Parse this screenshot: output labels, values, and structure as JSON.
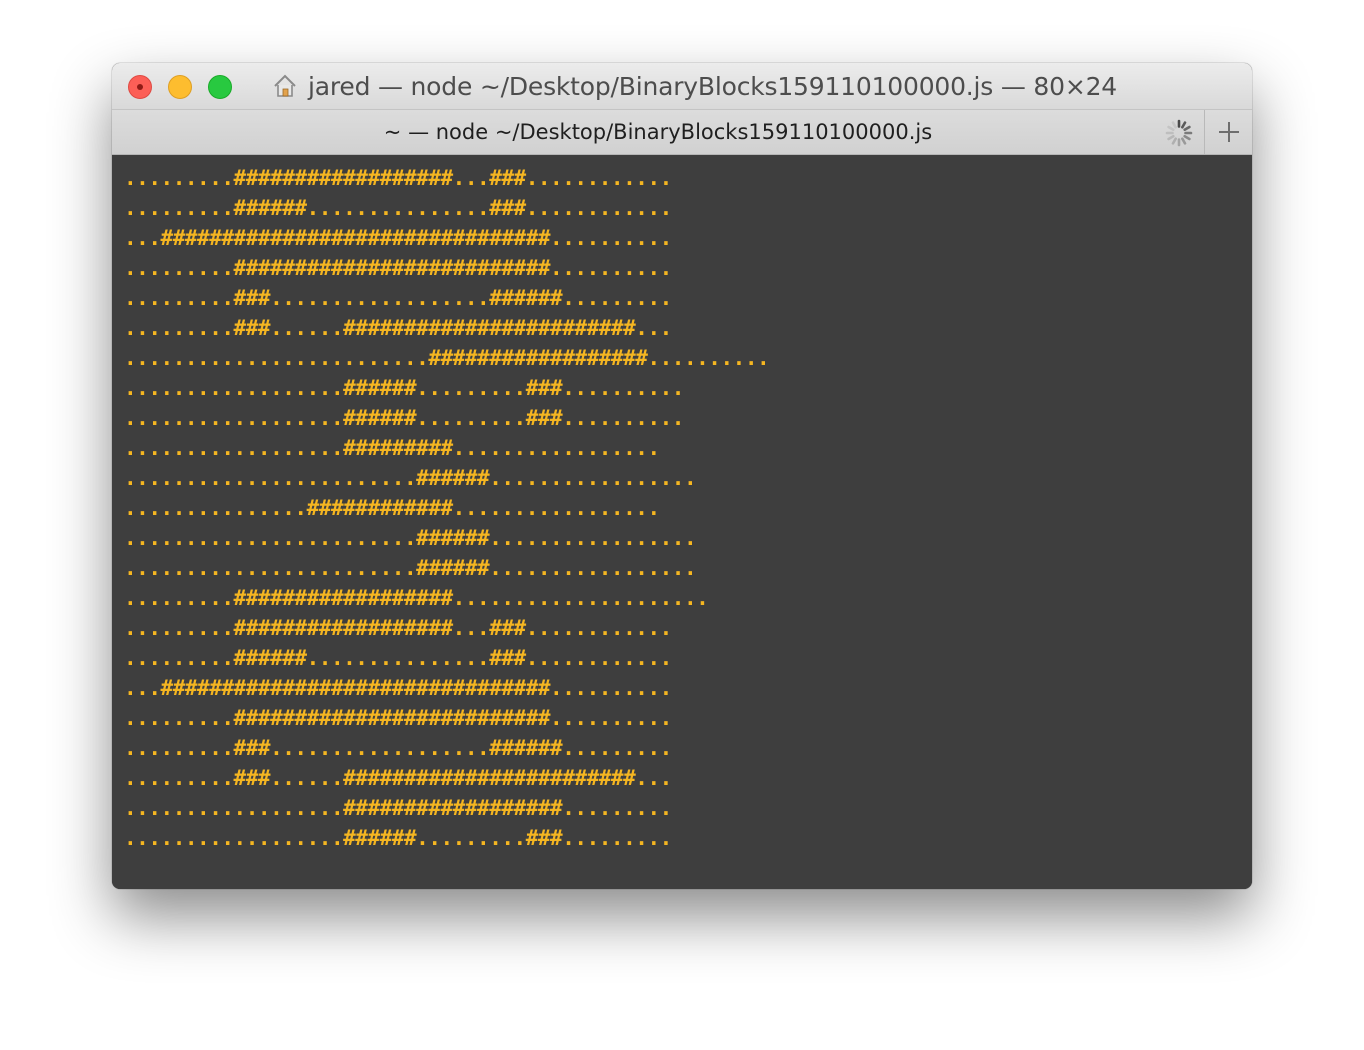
{
  "window": {
    "title": "jared — node ~/Desktop/BinaryBlocks159110100000.js — 80×24"
  },
  "tab": {
    "label": "~ — node ~/Desktop/BinaryBlocks159110100000.js"
  },
  "colors": {
    "terminal_background": "#3e3e3e",
    "terminal_text": "#f5b621",
    "cursor": "#f9cf68"
  },
  "icons": {
    "home": "home-icon",
    "spinner": "activity-spinner-icon",
    "new_tab": "plus-icon"
  },
  "terminal": {
    "lines": [
      ".........##################...###............",
      ".........######...............###............",
      "...################################..........",
      ".........##########################..........",
      ".........###..................######.........",
      ".........###......########################...",
      ".........................##################..........",
      "..................######.........###..........",
      "..................######.........###..........",
      "..................#########.................",
      "........................######.................",
      "...............############.................",
      "........................######.................",
      "........................######.................",
      ".........##################.....................",
      ".........##################...###............",
      ".........######...............###............",
      "...################################..........",
      ".........##########################..........",
      ".........###..................######.........",
      ".........###......########################...",
      "..................##################.........",
      "..................######.........###.........",
      ""
    ]
  }
}
